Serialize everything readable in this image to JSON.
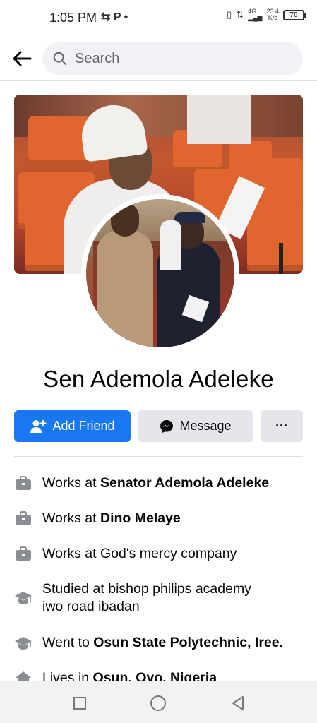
{
  "status_bar": {
    "time": "1:05 PM",
    "left_icons": "⇆ P •",
    "network": "4G",
    "speed_value": "23.4",
    "speed_unit": "K/s",
    "battery": "70"
  },
  "search": {
    "placeholder": "Search"
  },
  "profile": {
    "name": "Sen Ademola Adeleke"
  },
  "actions": {
    "add_friend": "Add Friend",
    "message": "Message",
    "more": "···"
  },
  "intro": [
    {
      "icon": "briefcase-icon",
      "prefix": "Works at ",
      "bold": "Senator Ademola Adeleke"
    },
    {
      "icon": "briefcase-icon",
      "prefix": "Works at ",
      "bold": "Dino Melaye"
    },
    {
      "icon": "briefcase-icon",
      "prefix": "Works at God's mercy company",
      "bold": ""
    },
    {
      "icon": "graduation-cap-icon",
      "prefix": "Studied at bishop philips academy iwo road ibadan",
      "bold": ""
    },
    {
      "icon": "graduation-cap-icon",
      "prefix": "Went to ",
      "bold": "Osun State Polytechnic, Iree."
    },
    {
      "icon": "home-icon",
      "prefix": "Lives in ",
      "bold": "Osun, Oyo, Nigeria"
    }
  ],
  "colors": {
    "primary": "#1877f2",
    "button_gray": "#e4e6eb",
    "text": "#050505",
    "secondary_text": "#65676b"
  }
}
